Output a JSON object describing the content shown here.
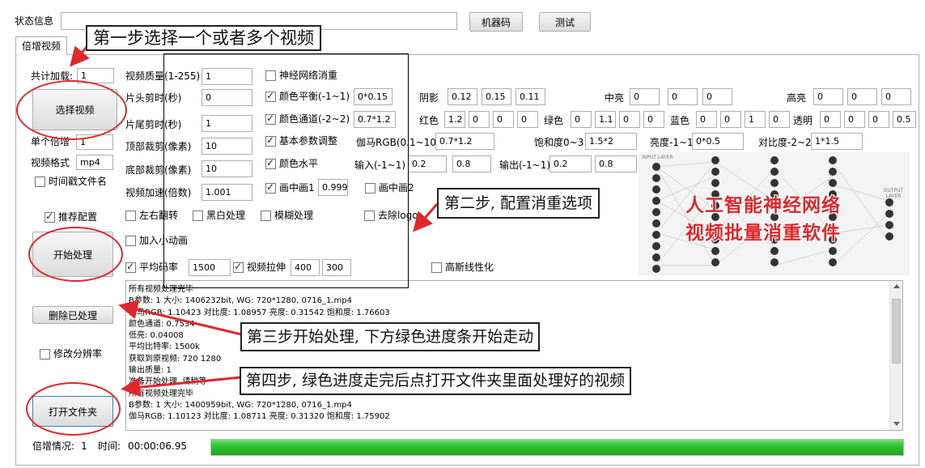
{
  "status": {
    "label": "状态信息",
    "machine_code": "机器码",
    "test": "测试"
  },
  "tab": "倍增视频",
  "left": {
    "total_label": "共计加载:",
    "total_value": "1",
    "select_video": "选择视频",
    "single_label": "单个倍增",
    "single_value": "1",
    "format_label": "视频格式",
    "format_value": "mp4",
    "timestamp_name": "时间戳文件名",
    "recommend": "推荐配置",
    "start": "开始处理",
    "delete_processed": "删除已处理",
    "modify_resolution": "修改分辨率",
    "open_folder": "打开文件夹"
  },
  "params": [
    {
      "label": "视频质量(1-255)",
      "value": "1"
    },
    {
      "label": "片头剪时(秒)",
      "value": "0"
    },
    {
      "label": "片尾剪时(秒)",
      "value": "1"
    },
    {
      "label": "顶部裁剪(像素)",
      "value": "10"
    },
    {
      "label": "底部裁剪(像素)",
      "value": "10"
    },
    {
      "label": "视频加速(倍数)",
      "value": "1.001"
    }
  ],
  "options": {
    "neural": "神经网络消重",
    "color_balance": "颜色平衡(-1~1)",
    "color_balance_v": "0*0.15",
    "shadow": "阴影",
    "shadow_v": [
      "0.12",
      "0.15",
      "0.11"
    ],
    "midtone": "中亮",
    "midtone_v": [
      "0",
      "0",
      "0"
    ],
    "highlight": "高亮",
    "highlight_v": [
      "0",
      "0",
      "0"
    ],
    "channel": "颜色通道(-2~2)",
    "channel_v": "0.7*1.2",
    "red": "红色",
    "red_v": [
      "1.2",
      "0",
      "0",
      "0"
    ],
    "green": "绿色",
    "green_v": [
      "0",
      "1.1",
      "0",
      "0"
    ],
    "blue": "蓝色",
    "blue_v": [
      "0",
      "0",
      "1",
      "0"
    ],
    "alpha": "透明",
    "alpha_v": [
      "0",
      "0",
      "0",
      "0.5"
    ],
    "basic": "基本参数调整",
    "gamma": "伽马RGB(0.1~10)",
    "gamma_v": "0.7*1.2",
    "saturation": "饱和度0~3",
    "saturation_v": "1.5*2",
    "brightness": "亮度-1~1",
    "brightness_v": "0*0.5",
    "contrast": "对比度-2~2",
    "contrast_v": "1*1.5",
    "level": "颜色水平",
    "input": "输入(-1~1)",
    "input_v": [
      "0.2",
      "0.8"
    ],
    "output": "输出(-1~1)",
    "output_v": [
      "0.2",
      "0.8"
    ],
    "pip1": "画中画1",
    "pip1_v": "0.999",
    "pip2": "画中画2",
    "flip": "左右翻转",
    "bw": "黑白处理",
    "blur": "模糊处理",
    "delogo": "去除logo",
    "anim": "加入小动画",
    "bitrate": "平均码率",
    "bitrate_v": "1500",
    "stretch": "视频拉伸",
    "stretch_w": "400",
    "stretch_h": "300",
    "gauss": "高斯线性化"
  },
  "banner": {
    "line1": "人工智能神经网络",
    "line2": "视频批量消重软件",
    "nn_in": "INPUT LAYER",
    "nn_out": "OUTPUT LAYER"
  },
  "log": [
    "所有视频处理完毕",
    "B参数: 1  大小: 1406232bit, WG: 720*1280,  0716_1.mp4",
    "伽马RGB: 1.10423 对比度: 1.08957 亮度: 0.31542 饱和度: 1.76603",
    "颜色通道: 0.7534",
    "低亮: 0.04008",
    "平均比特率: 1500k",
    "获取到原视频: 720  1280",
    "输出质量: 1",
    "准备开始处理, 请稍等",
    "所有视频处理完毕",
    "B参数: 1  大小: 1400959bit, WG: 720*1280,  0716_1.mp4",
    "伽马RGB: 1.10123 对比度: 1.08711 亮度: 0.31320 饱和度: 1.75902"
  ],
  "footer": {
    "rate_label": "倍增情况:",
    "rate_value": "1",
    "time_label": "时间:",
    "time_value": "00:00:06.95",
    "progress": 1.0
  },
  "steps": [
    "第一步选择一个或者多个视频",
    "第二步, 配置消重选项",
    "第三步开始处理, 下方绿色进度条开始走动",
    "第四步, 绿色进度走完后点打开文件夹里面处理好的视频"
  ],
  "colors": {
    "accent_red": "#e0282c",
    "progress_green": "#2fc02f"
  }
}
